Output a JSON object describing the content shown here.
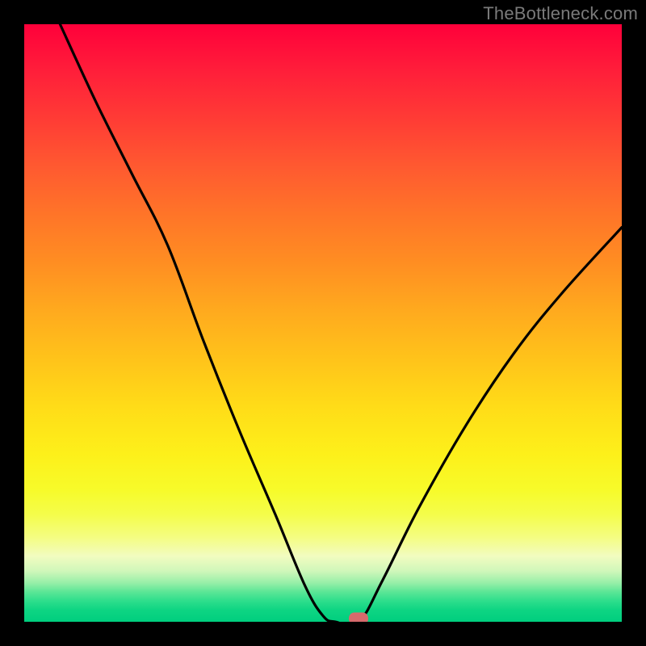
{
  "attribution": "TheBottleneck.com",
  "chart_data": {
    "type": "line",
    "title": "",
    "xlabel": "",
    "ylabel": "",
    "xlim": [
      0,
      100
    ],
    "ylim": [
      0,
      100
    ],
    "series": [
      {
        "name": "left-branch",
        "x": [
          6,
          12,
          18,
          24,
          30,
          36,
          42,
          47,
          50,
          52
        ],
        "y": [
          100,
          87,
          75,
          63,
          47,
          32,
          18,
          6,
          1,
          0
        ]
      },
      {
        "name": "plateau",
        "x": [
          52,
          56
        ],
        "y": [
          0,
          0
        ]
      },
      {
        "name": "right-branch",
        "x": [
          56,
          60,
          66,
          74,
          82,
          90,
          100
        ],
        "y": [
          0,
          7,
          19,
          33,
          45,
          55,
          66
        ]
      }
    ],
    "marker": {
      "x": 56,
      "y": 0
    },
    "gradient_stops": [
      {
        "pos": 0,
        "color": "#ff003a"
      },
      {
        "pos": 50,
        "color": "#ffaa1e"
      },
      {
        "pos": 80,
        "color": "#f7fb2a"
      },
      {
        "pos": 100,
        "color": "#00ce7e"
      }
    ]
  }
}
